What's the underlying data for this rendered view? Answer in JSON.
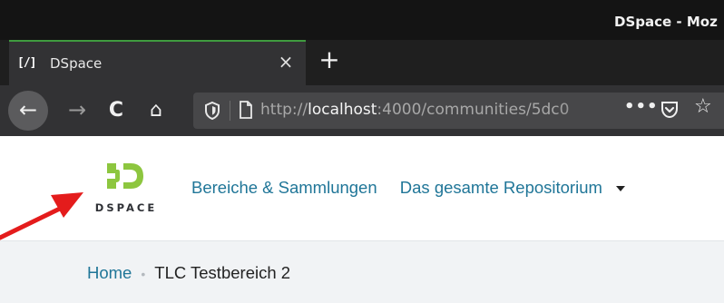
{
  "window": {
    "title": "DSpace - Moz"
  },
  "tab": {
    "favicon_text": "[/]",
    "title": "DSpace",
    "close_glyph": "×"
  },
  "newtab_glyph": "+",
  "toolbar": {
    "back_glyph": "←",
    "forward_glyph": "→",
    "reload_glyph": "C",
    "home_glyph": "⌂",
    "overflow_glyph": "•••",
    "star_glyph": "☆"
  },
  "url": {
    "scheme": "http://",
    "host": "localhost",
    "rest": ":4000/communities/5dc0"
  },
  "site": {
    "logo_text": "DSPACE",
    "logo_color": "#8dc63f",
    "nav": [
      {
        "label": "Bereiche & Sammlungen"
      },
      {
        "label": "Das gesamte Repositorium"
      }
    ],
    "link_color": "#207698"
  },
  "breadcrumb": {
    "home": "Home",
    "separator": "•",
    "current": "TLC Testbereich 2"
  },
  "annotation": {
    "arrow_color": "#e41c1c",
    "icon": "red-arrow-pointing-to-logo"
  }
}
